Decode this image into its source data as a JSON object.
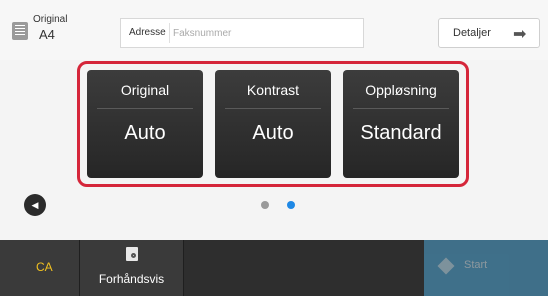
{
  "header": {
    "original_label": "Original",
    "original_size": "A4",
    "address_label": "Adresse",
    "address_placeholder": "Faksnummer",
    "address_value": "",
    "details_label": "Detaljer"
  },
  "settings": [
    {
      "title": "Original",
      "value": "Auto"
    },
    {
      "title": "Kontrast",
      "value": "Auto"
    },
    {
      "title": "Oppløsning",
      "value": "Standard"
    }
  ],
  "pager": {
    "page_count": 2,
    "current_page": 2,
    "active_color": "#1e88e5",
    "inactive_color": "#9a9a9a"
  },
  "highlight_color": "#d5263a",
  "footer": {
    "ca_label": "CA",
    "preview_label": "Forhåndsvis",
    "start_label": "Start"
  },
  "icons": {
    "original": "document-icon",
    "details": "arrow-right-icon",
    "back": "back-icon",
    "preview": "preview-magnifier-icon",
    "start": "start-diamond-icon"
  }
}
